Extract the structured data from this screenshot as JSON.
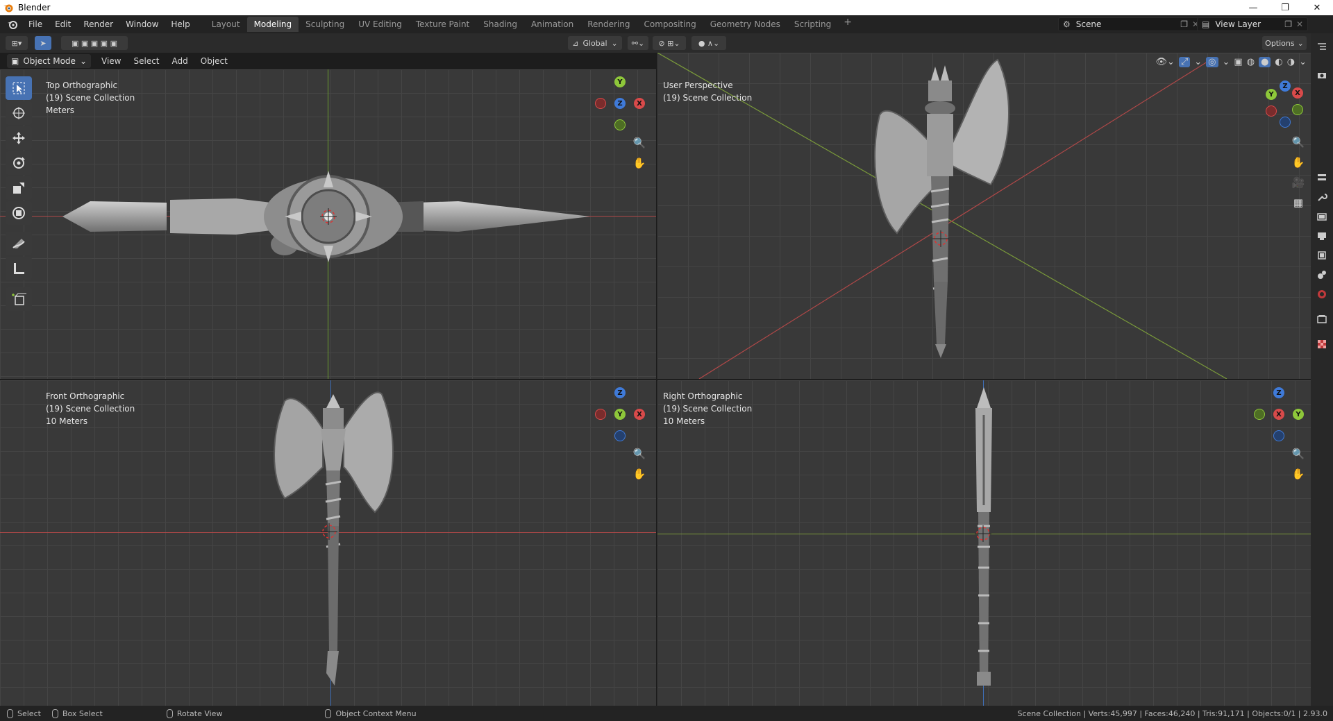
{
  "window": {
    "title": "Blender",
    "minimize": "—",
    "maximize": "❐",
    "close": "✕"
  },
  "menus": [
    "File",
    "Edit",
    "Render",
    "Window",
    "Help"
  ],
  "workspaces": [
    {
      "label": "Layout"
    },
    {
      "label": "Modeling",
      "active": true
    },
    {
      "label": "Sculpting"
    },
    {
      "label": "UV Editing"
    },
    {
      "label": "Texture Paint"
    },
    {
      "label": "Shading"
    },
    {
      "label": "Animation"
    },
    {
      "label": "Rendering"
    },
    {
      "label": "Compositing"
    },
    {
      "label": "Geometry Nodes"
    },
    {
      "label": "Scripting"
    }
  ],
  "scene": {
    "name": "Scene",
    "view_layer": "View Layer"
  },
  "header": {
    "transform_orientation": "Global",
    "options": "Options"
  },
  "viewport_header": {
    "mode": "Object Mode",
    "menus": [
      "View",
      "Select",
      "Add",
      "Object"
    ]
  },
  "viewports": {
    "top": {
      "view": "Top Orthographic",
      "collection": "(19) Scene Collection",
      "scale": "Meters"
    },
    "user": {
      "view": "User Perspective",
      "collection": "(19) Scene Collection"
    },
    "front": {
      "view": "Front Orthographic",
      "collection": "(19) Scene Collection",
      "scale": "10 Meters"
    },
    "right": {
      "view": "Right Orthographic",
      "collection": "(19) Scene Collection",
      "scale": "10 Meters"
    }
  },
  "gizmo_labels": {
    "x": "X",
    "y": "Y",
    "z": "Z"
  },
  "colors": {
    "x_axis": "#d84a4a",
    "y_axis": "#8ec73a",
    "z_axis": "#3f7ad8",
    "accent": "#4772b3"
  },
  "status": {
    "select": "Select",
    "box_select": "Box Select",
    "rotate_view": "Rotate View",
    "context_menu": "Object Context Menu",
    "stats": "Scene Collection | Verts:45,997 | Faces:46,240 | Tris:91,171 | Objects:0/1 | 2.93.0"
  }
}
